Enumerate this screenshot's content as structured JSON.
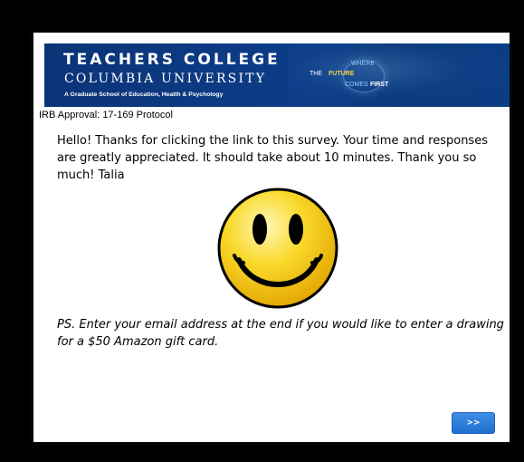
{
  "header": {
    "institution": "TEACHERS COLLEGE",
    "university": "COLUMBIA UNIVERSITY",
    "tagline": "A Graduate School of Education, Health & Psychology",
    "slogan": {
      "where": "WHERE",
      "the": "THE",
      "future": "FUTURE",
      "comes": "COMES",
      "first": "FIRST"
    }
  },
  "irb_approval": "IRB Approval: 17-169 Protocol",
  "intro_text": "Hello! Thanks for clicking the link to this survey. Your time and responses are greatly appreciated. It should take about 10 minutes. Thank you so much!  Talia",
  "ps_text": "PS. Enter your email address at the end if you would like to enter a drawing for a $50 Amazon gift card.",
  "next_button_label": ">>",
  "colors": {
    "banner_blue": "#0d3d88",
    "button_blue": "#2a7ad9",
    "smiley_yellow": "#f3c30b"
  }
}
